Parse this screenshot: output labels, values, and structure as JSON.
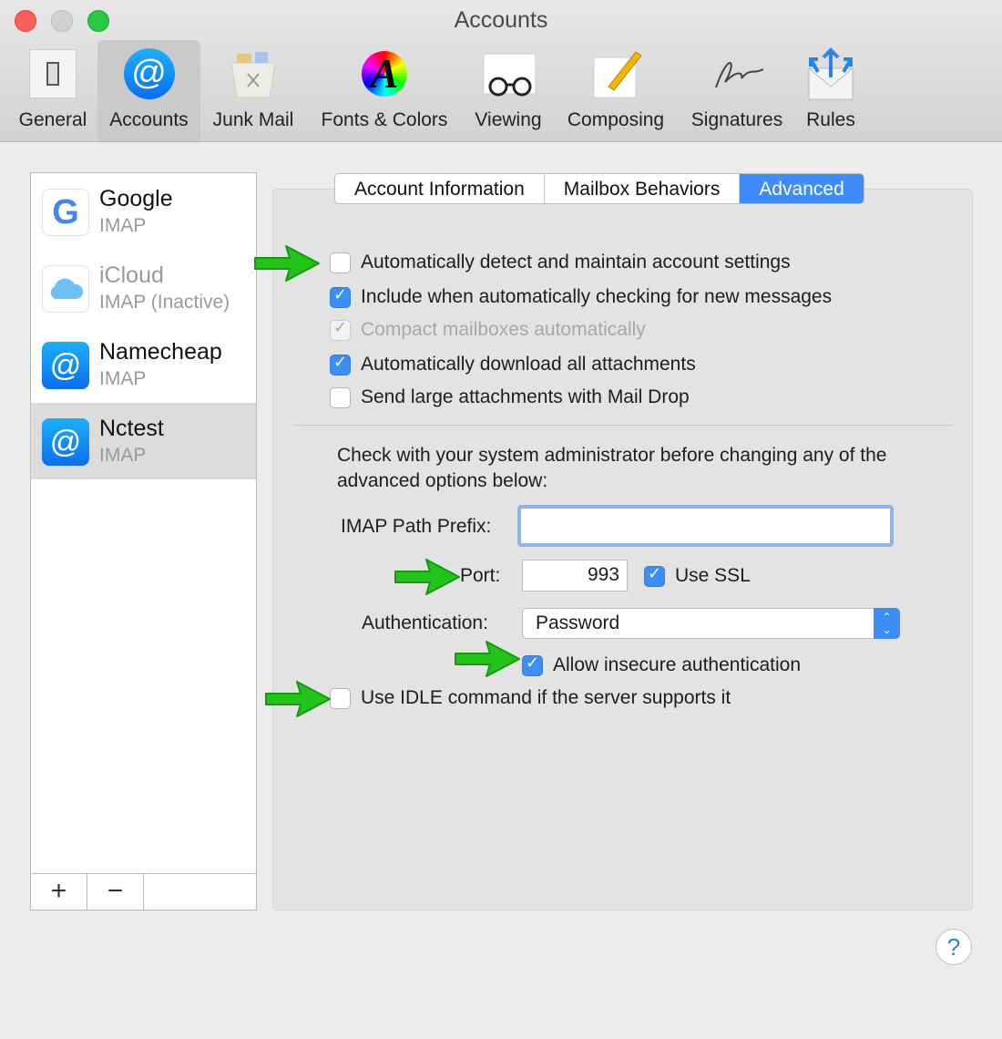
{
  "window": {
    "title": "Accounts"
  },
  "toolbar": {
    "items": [
      {
        "label": "General",
        "icon": "general-switch-icon"
      },
      {
        "label": "Accounts",
        "icon": "at-sign-icon",
        "selected": true
      },
      {
        "label": "Junk Mail",
        "icon": "trash-can-icon"
      },
      {
        "label": "Fonts & Colors",
        "icon": "color-wheel-font-icon"
      },
      {
        "label": "Viewing",
        "icon": "glasses-letter-icon"
      },
      {
        "label": "Composing",
        "icon": "pencil-paper-icon"
      },
      {
        "label": "Signatures",
        "icon": "signature-icon"
      },
      {
        "label": "Rules",
        "icon": "envelope-arrows-icon"
      }
    ]
  },
  "accounts": [
    {
      "name": "Google",
      "type": "IMAP"
    },
    {
      "name": "iCloud",
      "type": "IMAP (Inactive)",
      "inactive": true
    },
    {
      "name": "Namecheap",
      "type": "IMAP"
    },
    {
      "name": "Nctest",
      "type": "IMAP",
      "selected": true
    }
  ],
  "list_buttons": {
    "add": "+",
    "remove": "−"
  },
  "tabs": [
    "Account Information",
    "Mailbox Behaviors",
    "Advanced"
  ],
  "active_tab": "Advanced",
  "options": [
    {
      "label": "Automatically detect and maintain account settings",
      "checked": false
    },
    {
      "label": "Include when automatically checking for new messages",
      "checked": true
    },
    {
      "label": "Compact mailboxes automatically",
      "checked": true,
      "disabled": true
    },
    {
      "label": "Automatically download all attachments",
      "checked": true
    },
    {
      "label": "Send large attachments with Mail Drop",
      "checked": false
    }
  ],
  "advanced": {
    "note": "Check with your system administrator before changing any of the advanced options below:",
    "prefix_label": "IMAP Path Prefix:",
    "prefix_value": "",
    "port_label": "Port:",
    "port_value": "993",
    "ssl_label": "Use SSL",
    "ssl_checked": true,
    "auth_label": "Authentication:",
    "auth_value": "Password",
    "insecure_label": "Allow insecure authentication",
    "insecure_checked": true,
    "idle_label": "Use IDLE command if the server supports it",
    "idle_checked": false
  },
  "help": "?",
  "colors": {
    "accent": "#3a8ef6",
    "annotation_arrow": "#22c41a"
  }
}
